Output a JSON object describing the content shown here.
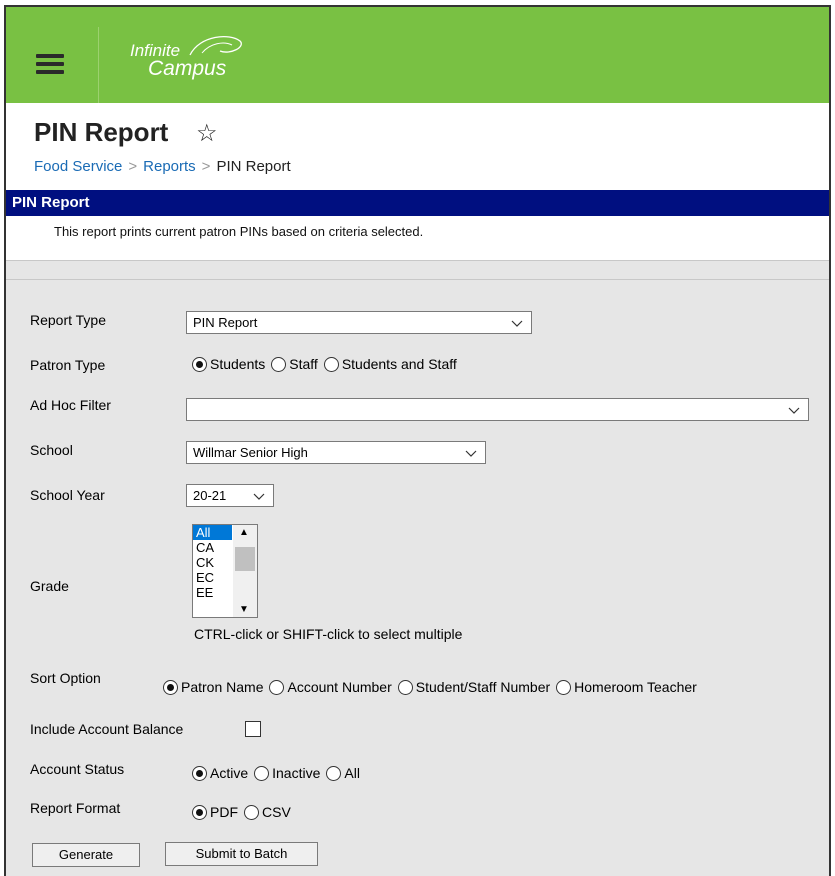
{
  "header": {
    "logo_line1": "Infinite",
    "logo_line2": "Campus",
    "brand_color": "#79c143"
  },
  "page": {
    "title": "PIN Report",
    "breadcrumb": [
      "Food Service",
      "Reports",
      "PIN Report"
    ]
  },
  "panel": {
    "title": "PIN Report",
    "description": "This report prints current patron PINs based on criteria selected."
  },
  "form": {
    "report_type": {
      "label": "Report Type",
      "value": "PIN Report"
    },
    "patron_type": {
      "label": "Patron Type",
      "options": [
        "Students",
        "Staff",
        "Students and Staff"
      ],
      "selected": "Students"
    },
    "ad_hoc_filter": {
      "label": "Ad Hoc Filter",
      "value": ""
    },
    "school": {
      "label": "School",
      "value": "Willmar Senior High"
    },
    "school_year": {
      "label": "School Year",
      "value": "20-21"
    },
    "grade": {
      "label": "Grade",
      "options": [
        "All",
        "CA",
        "CK",
        "EC",
        "EE"
      ],
      "selected": "All",
      "hint": "CTRL-click or SHIFT-click to select multiple"
    },
    "sort_option": {
      "label": "Sort Option",
      "options": [
        "Patron Name",
        "Account Number",
        "Student/Staff Number",
        "Homeroom Teacher"
      ],
      "selected": "Patron Name"
    },
    "include_balance": {
      "label": "Include Account Balance",
      "checked": false
    },
    "account_status": {
      "label": "Account Status",
      "options": [
        "Active",
        "Inactive",
        "All"
      ],
      "selected": "Active"
    },
    "report_format": {
      "label": "Report Format",
      "options": [
        "PDF",
        "CSV"
      ],
      "selected": "PDF"
    }
  },
  "buttons": {
    "generate": "Generate",
    "submit_batch": "Submit to Batch"
  }
}
